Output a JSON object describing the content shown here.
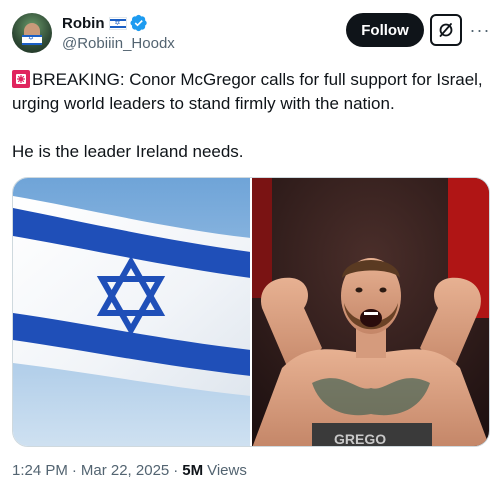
{
  "author": {
    "display_name": "Robin",
    "handle": "@Robiiin_Hoodx",
    "name_flag_icon": "israel-flag-icon",
    "verified_icon": "verified-badge-icon",
    "verified_color": "#1d9bf0"
  },
  "actions": {
    "follow_label": "Follow",
    "grok_icon": "grok-icon",
    "more_icon": "more-icon",
    "more_glyph": "···"
  },
  "tweet": {
    "siren_icon": "rotating-light-icon",
    "line1": "BREAKING: Conor McGregor calls for full support for Israel, urging world leaders to stand firmly with the nation.",
    "line2": "He is the leader Ireland needs."
  },
  "media": {
    "left_image": "israel-flag-photo",
    "right_image": "conor-mcgregor-flexing-photo",
    "shorts_text": "GREGO"
  },
  "meta": {
    "time": "1:24 PM",
    "separator": "·",
    "date": "Mar 22, 2025",
    "views_count": "5M",
    "views_label": "Views"
  },
  "colors": {
    "text_primary": "#0f1419",
    "text_secondary": "#536471",
    "flag_blue": "#1b5fc5",
    "button_bg": "#0f1419"
  }
}
